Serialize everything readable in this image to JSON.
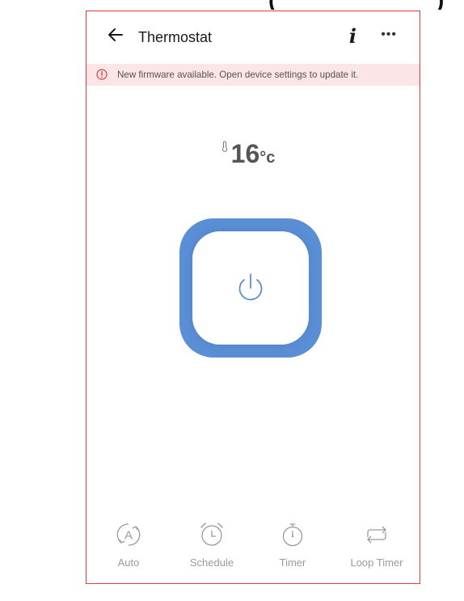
{
  "top_fragment": [
    "(",
    ")"
  ],
  "header": {
    "title": "Thermostat",
    "back_icon": "arrow-left-icon",
    "info_label": "i",
    "more_label": "•••"
  },
  "banner": {
    "icon": "warning-circle-icon",
    "message": "New firmware available. Open device settings to update it."
  },
  "temperature": {
    "icon": "thermometer-icon",
    "value": "16",
    "unit": "°c"
  },
  "power": {
    "icon": "power-icon",
    "state": "off"
  },
  "tabs": [
    {
      "label": "Auto",
      "icon": "auto-mode-icon"
    },
    {
      "label": "Schedule",
      "icon": "alarm-clock-icon"
    },
    {
      "label": "Timer",
      "icon": "stopwatch-icon"
    },
    {
      "label": "Loop Timer",
      "icon": "loop-arrows-icon"
    }
  ],
  "colors": {
    "accent": "#5a8fd5",
    "banner_bg": "#fbe5e6",
    "warning": "#e23b3b",
    "frame": "#e23b3b",
    "tab_text": "#9a9a9a"
  }
}
